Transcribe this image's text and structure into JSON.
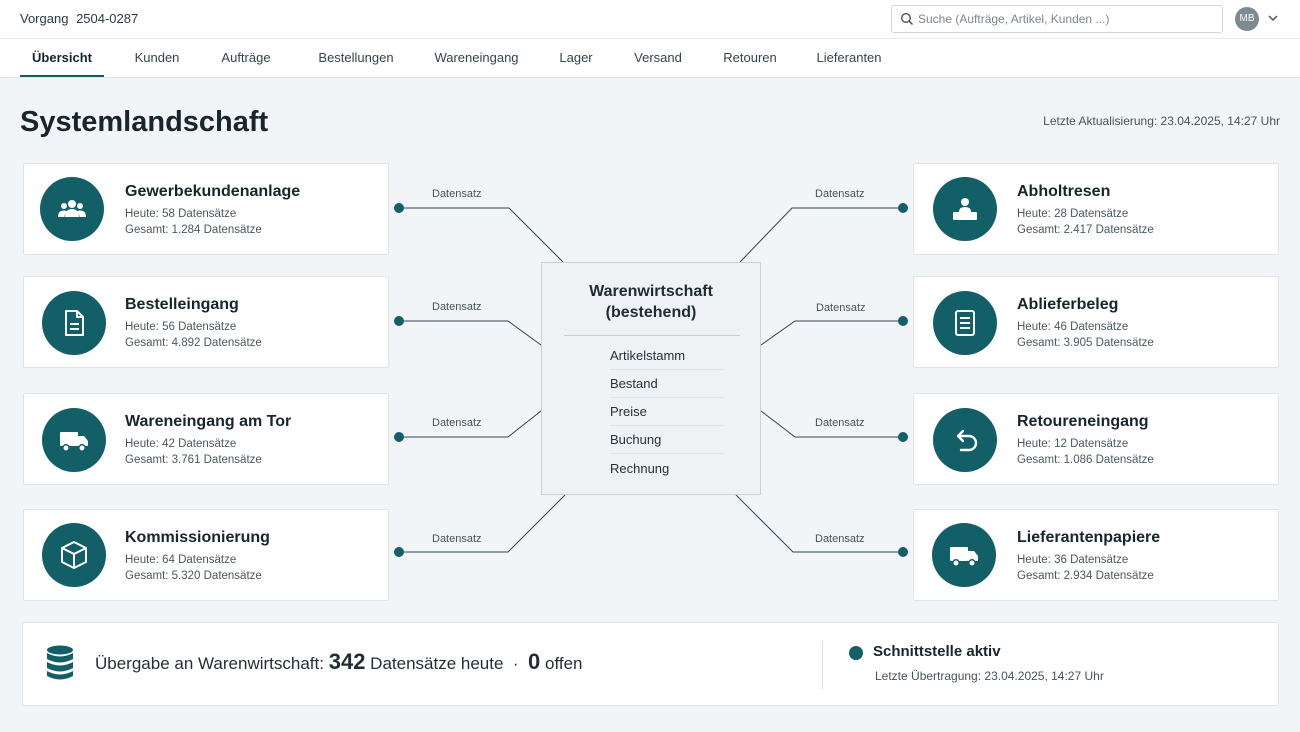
{
  "header": {
    "vorgang_label": "Vorgang",
    "vorgang_id": "2504-0287",
    "search_placeholder": "Suche (Aufträge, Artikel, Kunden ...)",
    "user_initials": "MB"
  },
  "nav": {
    "tabs": [
      {
        "label": "Übersicht",
        "active": true
      },
      {
        "label": "Kunden"
      },
      {
        "label": "Aufträge"
      },
      {
        "label": "Bestellungen"
      },
      {
        "label": "Wareneingang"
      },
      {
        "label": "Lager"
      },
      {
        "label": "Versand"
      },
      {
        "label": "Retouren"
      },
      {
        "label": "Lieferanten"
      }
    ]
  },
  "page": {
    "title": "Systemlandschaft",
    "updated": "Letzte Aktualisierung: 23.04.2025, 14:27 Uhr"
  },
  "connector_label": "Datensatz",
  "left_cards": [
    {
      "title": "Gewerbekundenanlage",
      "today": "Heute: 58 Datensätze",
      "total": "Gesamt: 1.284 Datensätze",
      "icon": "users-icon"
    },
    {
      "title": "Bestelleingang",
      "today": "Heute: 56 Datensätze",
      "total": "Gesamt: 4.892 Datensätze",
      "icon": "document-icon"
    },
    {
      "title": "Wareneingang am Tor",
      "today": "Heute: 42 Datensätze",
      "total": "Gesamt: 3.761 Datensätze",
      "icon": "truck-icon"
    },
    {
      "title": "Kommissionierung",
      "today": "Heute: 64 Datensätze",
      "total": "Gesamt: 5.320 Datensätze",
      "icon": "box-icon"
    }
  ],
  "right_cards": [
    {
      "title": "Abholtresen",
      "today": "Heute: 28 Datensätze",
      "total": "Gesamt: 2.417 Datensätze",
      "icon": "counter-icon"
    },
    {
      "title": "Ablieferbeleg",
      "today": "Heute: 46 Datensätze",
      "total": "Gesamt: 3.905 Datensätze",
      "icon": "receipt-icon"
    },
    {
      "title": "Retoureneingang",
      "today": "Heute: 12 Datensätze",
      "total": "Gesamt: 1.086 Datensätze",
      "icon": "return-icon"
    },
    {
      "title": "Lieferantenpapiere",
      "today": "Heute: 36 Datensätze",
      "total": "Gesamt: 2.934 Datensätze",
      "icon": "truck-icon"
    }
  ],
  "core": {
    "title_line1": "Warenwirtschaft",
    "title_line2": "(bestehend)",
    "items": [
      "Artikelstamm",
      "Bestand",
      "Preise",
      "Buchung",
      "Rechnung"
    ]
  },
  "footer": {
    "transfer_label": "Übergabe an Warenwirtschaft:",
    "today_count": "342",
    "today_suffix": "Datensätze heute",
    "separator": "·",
    "open_count": "0",
    "open_suffix": "offen",
    "status": "Schnittstelle aktiv",
    "last_transfer": "Letzte Übertragung: 23.04.2025, 14:27 Uhr"
  },
  "colors": {
    "accent": "#135f68",
    "background": "#f2f5f7"
  }
}
